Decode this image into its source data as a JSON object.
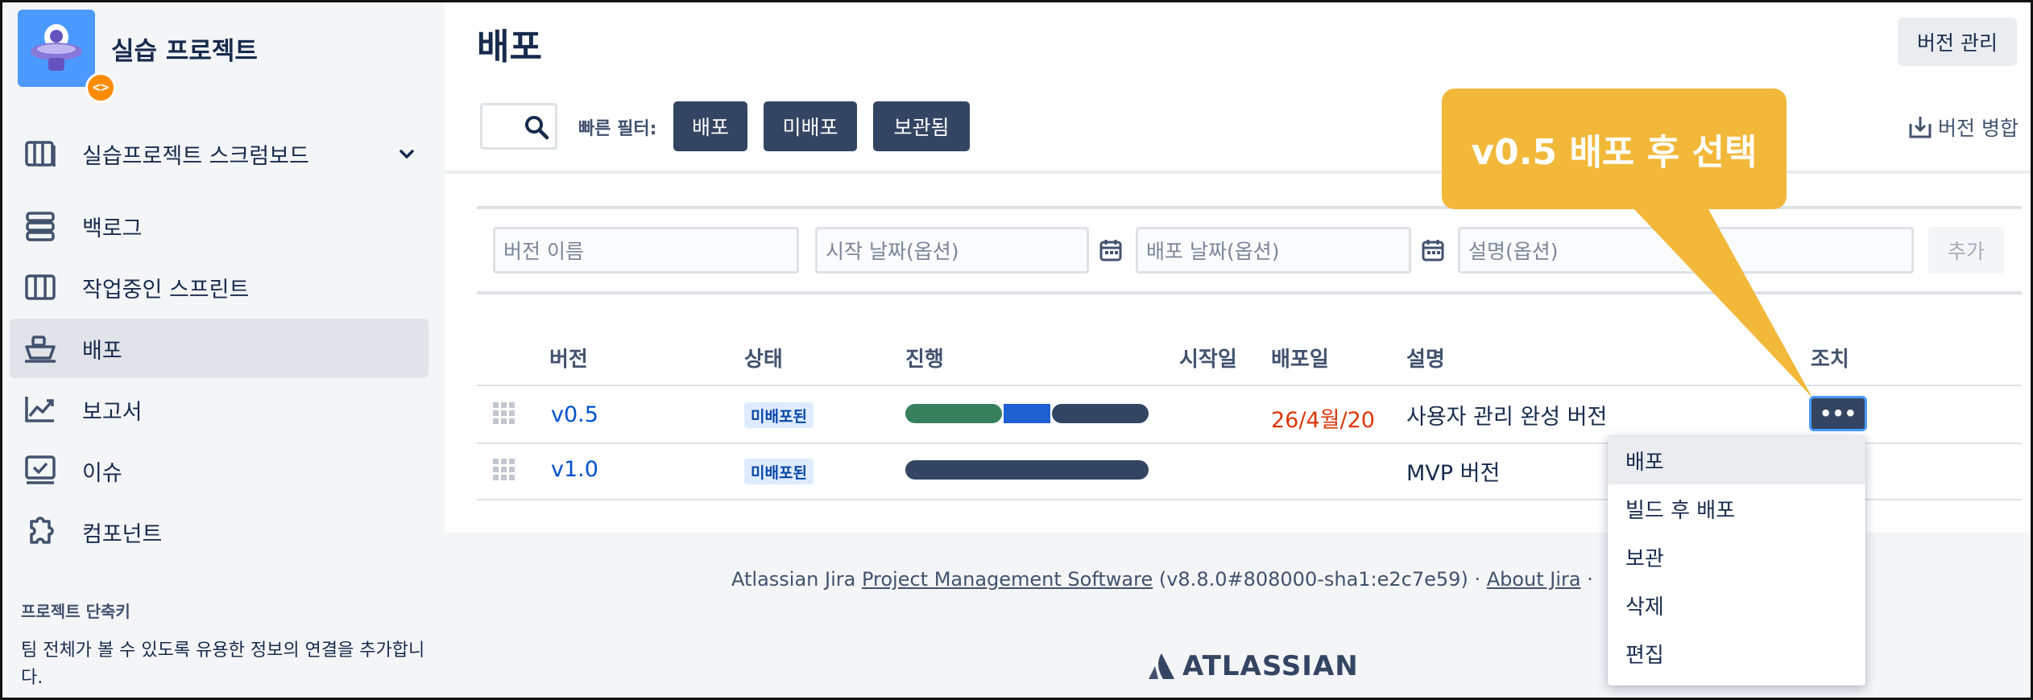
{
  "project": {
    "name": "실습 프로젝트",
    "badge": "<>"
  },
  "sidebar": {
    "board": "실습프로젝트 스크럼보드",
    "items": [
      {
        "label": "백로그",
        "icon": "backlog-icon"
      },
      {
        "label": "작업중인 스프린트",
        "icon": "board-icon"
      },
      {
        "label": "배포",
        "icon": "ship-icon"
      },
      {
        "label": "보고서",
        "icon": "chart-icon"
      },
      {
        "label": "이슈",
        "icon": "issues-icon"
      },
      {
        "label": "컴포넌트",
        "icon": "puzzle-icon"
      }
    ],
    "shortcut_title": "프로젝트 단축키",
    "shortcut_text": "팀 전체가 볼 수 있도록 유용한 정보의 연결을 추가합니다."
  },
  "header": {
    "title": "배포",
    "manage_button": "버전 관리",
    "filter_label": "빠른 필터:",
    "filters": [
      "배포",
      "미배포",
      "보관됨"
    ],
    "merge": "버전 병합"
  },
  "form": {
    "name_placeholder": "버전 이름",
    "start_placeholder": "시작 날짜(옵션)",
    "release_placeholder": "배포 날짜(옵션)",
    "desc_placeholder": "설명(옵션)",
    "add_button": "추가"
  },
  "table": {
    "headers": [
      "버전",
      "상태",
      "진행",
      "시작일",
      "배포일",
      "설명",
      "조치"
    ],
    "rows": [
      {
        "version": "v0.5",
        "status": "미배포된",
        "start": "",
        "release": "26/4월/20",
        "desc": "사용자 관리 완성 버전",
        "progress": [
          0.4,
          0.19,
          0.41
        ]
      },
      {
        "version": "v1.0",
        "status": "미배포된",
        "start": "",
        "release": "",
        "desc": "MVP 버전",
        "progress": [
          0,
          0,
          1
        ]
      }
    ],
    "action_label": "•••"
  },
  "dropdown": [
    "배포",
    "빌드 후 배포",
    "보관",
    "삭제",
    "편집"
  ],
  "footer": {
    "prefix": "Atlassian Jira ",
    "link": "Project Management Software",
    "version": " (v8.8.0#808000-sha1:e2c7e59)",
    "sep": "  ·  ",
    "about": "About Jira",
    "sep2": "  ·",
    "logo": "ATLASSIAN"
  },
  "callout": "v0.5 배포 후 선택",
  "colors": {
    "done": "#36805E",
    "inprogress": "#1F5FD1",
    "todo": "#344563",
    "accent": "#0052CC",
    "callout": "#F2B83A"
  }
}
